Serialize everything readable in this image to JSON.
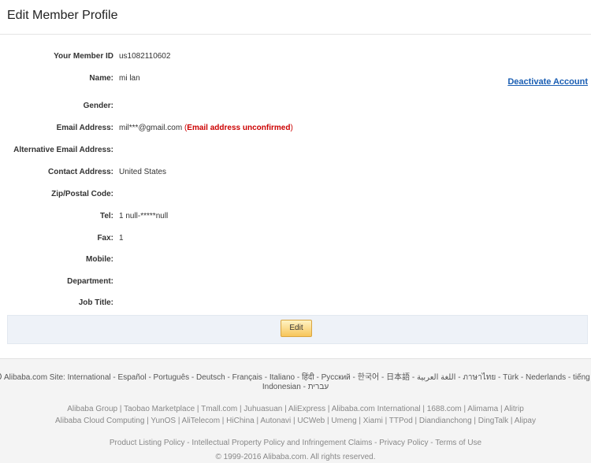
{
  "header": {
    "title": "Edit Member Profile"
  },
  "actions": {
    "deactivate_label": "Deactivate Account",
    "edit_label": "Edit"
  },
  "profile": {
    "member_id": {
      "label": "Your Member ID",
      "value": "us1082110602"
    },
    "name": {
      "label": "Name:",
      "value": "mi lan"
    },
    "gender": {
      "label": "Gender:",
      "value": ""
    },
    "email": {
      "label": "Email Address:",
      "value": "mil***@gmail.com",
      "status_open": " (",
      "status": "Email address unconfirmed",
      "status_close": ")"
    },
    "alt_email": {
      "label": "Alternative Email Address:",
      "value": ""
    },
    "contact_address": {
      "label": "Contact Address:",
      "value": "United States"
    },
    "zip": {
      "label": "Zip/Postal Code:",
      "value": ""
    },
    "tel": {
      "label": "Tel:",
      "value": "1 null-*****null"
    },
    "fax": {
      "label": "Fax:",
      "value": "1"
    },
    "mobile": {
      "label": "Mobile:",
      "value": ""
    },
    "department": {
      "label": "Department:",
      "value": ""
    },
    "job_title": {
      "label": "Job Title:",
      "value": ""
    }
  },
  "footer": {
    "sites_line1": "Alibaba.com Site: International - Español - Português - Deutsch - Français - Italiano - हिंदी - Pусский - 한국어 - 日本語 - اللغة العربية - ภาษาไทย - Türk - Nederlands - tiếng Việt",
    "sites_line2": "Indonesian - עברית",
    "group_line1": "Alibaba Group | Taobao Marketplace | Tmall.com | Juhuasuan | AliExpress | Alibaba.com International | 1688.com | Alimama | Alitrip",
    "group_line2": "Alibaba Cloud Computing | YunOS | AliTelecom | HiChina | Autonavi | UCWeb | Umeng | Xiami | TTPod | Diandianchong | DingTalk | Alipay",
    "policy_line": "Product Listing Policy - Intellectual Property Policy and Infringement Claims - Privacy Policy - Terms of Use",
    "copyright": "© 1999-2016 Alibaba.com. All rights reserved."
  },
  "colors": {
    "link": "#1a5eb3",
    "warning": "#cc0000",
    "button": "#f7c55a"
  }
}
